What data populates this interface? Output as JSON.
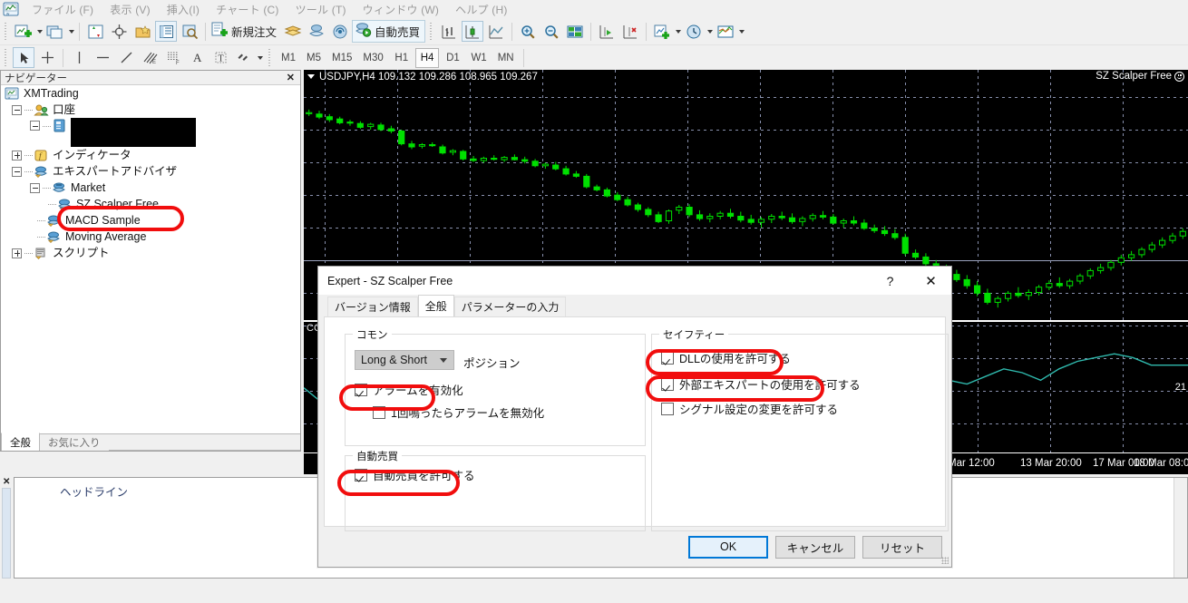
{
  "app": {
    "logo_icon": "mt4-app-icon",
    "menu": [
      {
        "label": "ファイル (F)"
      },
      {
        "label": "表示 (V)"
      },
      {
        "label": "挿入(I)"
      },
      {
        "label": "チャート (C)"
      },
      {
        "label": "ツール (T)"
      },
      {
        "label": "ウィンドウ (W)"
      },
      {
        "label": "ヘルプ (H)"
      }
    ]
  },
  "toolbar": {
    "new_order_label": "新規注文",
    "autotrade_label": "自動売買",
    "timeframes": [
      {
        "label": "M1",
        "active": false
      },
      {
        "label": "M5",
        "active": false
      },
      {
        "label": "M15",
        "active": false
      },
      {
        "label": "M30",
        "active": false
      },
      {
        "label": "H1",
        "active": false
      },
      {
        "label": "H4",
        "active": true
      },
      {
        "label": "D1",
        "active": false
      },
      {
        "label": "W1",
        "active": false
      },
      {
        "label": "MN",
        "active": false
      }
    ]
  },
  "navigator": {
    "title": "ナビゲーター",
    "close_label": "✕",
    "tree": {
      "root": "XMTrading",
      "accounts_label": "口座",
      "account_redacted": "",
      "indicators_label": "インディケータ",
      "experts_label": "エキスパートアドバイザ",
      "market_label": "Market",
      "expert_items": [
        {
          "label": "SZ Scalper Free",
          "highlighted": true
        },
        {
          "label": "MACD Sample",
          "highlighted": false
        },
        {
          "label": "Moving Average",
          "highlighted": false
        }
      ],
      "scripts_label": "スクリプト"
    },
    "tabs": [
      {
        "label": "全般",
        "selected": true
      },
      {
        "label": "お気に入り",
        "selected": false
      }
    ]
  },
  "terminal": {
    "close_label": "✕",
    "headline_label": "ヘッドライン"
  },
  "chart_data": {
    "type": "line",
    "title": "USDJPY,H4  109.132 109.286 108.965 109.267",
    "symbol": "USDJPY",
    "timeframe": "H4",
    "ohlc": {
      "open": "109.132",
      "high": "109.286",
      "low": "108.965",
      "close": "109.267"
    },
    "expert_label": "SZ Scalper Free",
    "expert_status_icon": "smiley-face-icon",
    "grid": true,
    "candle_color": "#00e000",
    "indicator_color": "#2fb9ad",
    "subwindow_label": "CCI",
    "xlabel": "",
    "ylabel": "",
    "x_ticks": [
      "Mar 12:00",
      "13 Mar 20:00",
      "17 Mar 00:00",
      "18 Mar 08:00"
    ],
    "x_tick_positions": [
      710,
      790,
      870,
      915
    ],
    "y_ticks": [
      "21"
    ],
    "candles": [
      {
        "o": 109.95,
        "h": 110.05,
        "l": 109.88,
        "c": 109.97
      },
      {
        "o": 109.93,
        "h": 110.02,
        "l": 109.8,
        "c": 109.85
      },
      {
        "o": 109.86,
        "h": 109.93,
        "l": 109.72,
        "c": 109.78
      },
      {
        "o": 109.8,
        "h": 109.86,
        "l": 109.66,
        "c": 109.7
      },
      {
        "o": 109.72,
        "h": 109.78,
        "l": 109.62,
        "c": 109.69
      },
      {
        "o": 109.68,
        "h": 109.74,
        "l": 109.54,
        "c": 109.58
      },
      {
        "o": 109.6,
        "h": 109.7,
        "l": 109.52,
        "c": 109.66
      },
      {
        "o": 109.64,
        "h": 109.7,
        "l": 109.48,
        "c": 109.52
      },
      {
        "o": 109.54,
        "h": 109.62,
        "l": 109.42,
        "c": 109.48
      },
      {
        "o": 109.48,
        "h": 109.52,
        "l": 109.1,
        "c": 109.14
      },
      {
        "o": 109.14,
        "h": 109.22,
        "l": 109.0,
        "c": 109.06
      },
      {
        "o": 109.08,
        "h": 109.16,
        "l": 109.02,
        "c": 109.12
      },
      {
        "o": 109.12,
        "h": 109.18,
        "l": 109.06,
        "c": 109.1
      },
      {
        "o": 109.06,
        "h": 109.12,
        "l": 108.86,
        "c": 108.9
      },
      {
        "o": 108.92,
        "h": 109.0,
        "l": 108.84,
        "c": 108.96
      },
      {
        "o": 108.94,
        "h": 108.98,
        "l": 108.7,
        "c": 108.74
      },
      {
        "o": 108.74,
        "h": 108.82,
        "l": 108.66,
        "c": 108.7
      },
      {
        "o": 108.7,
        "h": 108.8,
        "l": 108.64,
        "c": 108.76
      },
      {
        "o": 108.76,
        "h": 108.84,
        "l": 108.7,
        "c": 108.74
      },
      {
        "o": 108.72,
        "h": 108.82,
        "l": 108.66,
        "c": 108.78
      },
      {
        "o": 108.78,
        "h": 108.86,
        "l": 108.7,
        "c": 108.72
      },
      {
        "o": 108.72,
        "h": 108.8,
        "l": 108.62,
        "c": 108.68
      },
      {
        "o": 108.68,
        "h": 108.74,
        "l": 108.52,
        "c": 108.56
      },
      {
        "o": 108.56,
        "h": 108.64,
        "l": 108.48,
        "c": 108.6
      },
      {
        "o": 108.58,
        "h": 108.66,
        "l": 108.44,
        "c": 108.48
      },
      {
        "o": 108.48,
        "h": 108.56,
        "l": 108.3,
        "c": 108.34
      },
      {
        "o": 108.34,
        "h": 108.42,
        "l": 108.24,
        "c": 108.28
      },
      {
        "o": 108.28,
        "h": 108.34,
        "l": 107.96,
        "c": 108.0
      },
      {
        "o": 108.0,
        "h": 108.06,
        "l": 107.88,
        "c": 107.92
      },
      {
        "o": 107.92,
        "h": 107.98,
        "l": 107.72,
        "c": 107.76
      },
      {
        "o": 107.78,
        "h": 107.86,
        "l": 107.62,
        "c": 107.66
      },
      {
        "o": 107.66,
        "h": 107.74,
        "l": 107.48,
        "c": 107.52
      },
      {
        "o": 107.52,
        "h": 107.58,
        "l": 107.34,
        "c": 107.4
      },
      {
        "o": 107.4,
        "h": 107.46,
        "l": 107.2,
        "c": 107.26
      },
      {
        "o": 107.26,
        "h": 107.34,
        "l": 107.04,
        "c": 107.08
      },
      {
        "o": 107.1,
        "h": 107.4,
        "l": 107.02,
        "c": 107.36
      },
      {
        "o": 107.38,
        "h": 107.52,
        "l": 107.28,
        "c": 107.46
      },
      {
        "o": 107.46,
        "h": 107.54,
        "l": 107.2,
        "c": 107.26
      },
      {
        "o": 107.26,
        "h": 107.38,
        "l": 107.1,
        "c": 107.16
      },
      {
        "o": 107.16,
        "h": 107.3,
        "l": 107.06,
        "c": 107.22
      },
      {
        "o": 107.22,
        "h": 107.36,
        "l": 107.14,
        "c": 107.3
      },
      {
        "o": 107.3,
        "h": 107.42,
        "l": 107.16,
        "c": 107.22
      },
      {
        "o": 107.22,
        "h": 107.34,
        "l": 107.06,
        "c": 107.12
      },
      {
        "o": 107.14,
        "h": 107.26,
        "l": 107.0,
        "c": 107.06
      },
      {
        "o": 107.06,
        "h": 107.2,
        "l": 106.92,
        "c": 107.14
      },
      {
        "o": 107.14,
        "h": 107.28,
        "l": 107.04,
        "c": 107.22
      },
      {
        "o": 107.22,
        "h": 107.34,
        "l": 107.12,
        "c": 107.18
      },
      {
        "o": 107.18,
        "h": 107.3,
        "l": 107.02,
        "c": 107.08
      },
      {
        "o": 107.08,
        "h": 107.22,
        "l": 106.96,
        "c": 107.16
      },
      {
        "o": 107.16,
        "h": 107.3,
        "l": 107.08,
        "c": 107.24
      },
      {
        "o": 107.24,
        "h": 107.36,
        "l": 107.14,
        "c": 107.2
      },
      {
        "o": 107.2,
        "h": 107.28,
        "l": 107.0,
        "c": 107.04
      },
      {
        "o": 107.04,
        "h": 107.16,
        "l": 106.92,
        "c": 107.1
      },
      {
        "o": 107.1,
        "h": 107.22,
        "l": 106.98,
        "c": 107.04
      },
      {
        "o": 107.04,
        "h": 107.14,
        "l": 106.86,
        "c": 106.9
      },
      {
        "o": 106.9,
        "h": 107.0,
        "l": 106.78,
        "c": 106.84
      },
      {
        "o": 106.84,
        "h": 106.96,
        "l": 106.7,
        "c": 106.76
      },
      {
        "o": 106.76,
        "h": 106.88,
        "l": 106.6,
        "c": 106.66
      },
      {
        "o": 106.66,
        "h": 106.76,
        "l": 106.18,
        "c": 106.24
      },
      {
        "o": 106.24,
        "h": 106.34,
        "l": 106.08,
        "c": 106.14
      },
      {
        "o": 106.14,
        "h": 106.24,
        "l": 105.9,
        "c": 105.96
      },
      {
        "o": 105.96,
        "h": 106.06,
        "l": 105.78,
        "c": 105.84
      },
      {
        "o": 105.84,
        "h": 105.94,
        "l": 105.62,
        "c": 105.68
      },
      {
        "o": 105.68,
        "h": 105.8,
        "l": 105.48,
        "c": 105.54
      },
      {
        "o": 105.54,
        "h": 105.66,
        "l": 105.3,
        "c": 105.38
      },
      {
        "o": 105.38,
        "h": 105.5,
        "l": 105.1,
        "c": 105.18
      },
      {
        "o": 105.18,
        "h": 105.3,
        "l": 104.88,
        "c": 104.94
      },
      {
        "o": 104.94,
        "h": 105.1,
        "l": 104.8,
        "c": 105.04
      },
      {
        "o": 105.04,
        "h": 105.24,
        "l": 104.96,
        "c": 105.18
      },
      {
        "o": 105.18,
        "h": 105.34,
        "l": 105.06,
        "c": 105.12
      },
      {
        "o": 105.12,
        "h": 105.28,
        "l": 105.0,
        "c": 105.2
      },
      {
        "o": 105.2,
        "h": 105.4,
        "l": 105.12,
        "c": 105.34
      },
      {
        "o": 105.34,
        "h": 105.52,
        "l": 105.26,
        "c": 105.44
      },
      {
        "o": 105.44,
        "h": 105.6,
        "l": 105.32,
        "c": 105.38
      },
      {
        "o": 105.38,
        "h": 105.56,
        "l": 105.3,
        "c": 105.5
      },
      {
        "o": 105.5,
        "h": 105.7,
        "l": 105.42,
        "c": 105.64
      },
      {
        "o": 105.64,
        "h": 105.84,
        "l": 105.56,
        "c": 105.78
      },
      {
        "o": 105.78,
        "h": 105.96,
        "l": 105.7,
        "c": 105.86
      },
      {
        "o": 105.86,
        "h": 106.06,
        "l": 105.78,
        "c": 106.0
      },
      {
        "o": 106.0,
        "h": 106.2,
        "l": 105.92,
        "c": 106.12
      },
      {
        "o": 106.12,
        "h": 106.3,
        "l": 106.04,
        "c": 106.2
      },
      {
        "o": 106.2,
        "h": 106.4,
        "l": 106.12,
        "c": 106.34
      },
      {
        "o": 106.34,
        "h": 106.54,
        "l": 106.26,
        "c": 106.46
      },
      {
        "o": 106.46,
        "h": 106.66,
        "l": 106.38,
        "c": 106.58
      },
      {
        "o": 106.58,
        "h": 106.78,
        "l": 106.5,
        "c": 106.7
      },
      {
        "o": 106.7,
        "h": 106.9,
        "l": 106.62,
        "c": 106.82
      }
    ],
    "indicator_values": [
      14,
      10,
      8,
      12,
      17,
      21,
      24,
      26,
      25,
      23,
      20,
      18,
      17,
      16,
      14,
      9,
      5,
      4,
      5,
      6,
      6,
      7,
      9,
      7,
      7,
      8,
      10,
      12,
      15,
      18,
      21,
      23,
      22,
      20,
      18,
      16,
      15,
      17,
      19,
      18,
      16,
      19,
      21,
      22,
      23,
      22,
      20,
      20,
      20
    ],
    "indicator_range": [
      0,
      30
    ]
  },
  "dialog": {
    "title": "Expert - SZ Scalper Free",
    "help_label": "?",
    "close_label": "✕",
    "tabs": [
      {
        "label": "バージョン情報",
        "selected": false
      },
      {
        "label": "全般",
        "selected": true
      },
      {
        "label": "パラメーターの入力",
        "selected": false
      }
    ],
    "common": {
      "legend": "コモン",
      "position_value": "Long & Short",
      "position_label": "ポジション",
      "enable_alarm": {
        "label": "アラームを有効化",
        "checked": true,
        "highlighted": true
      },
      "disable_after_one": {
        "label": "1回鳴ったらアラームを無効化",
        "checked": false,
        "highlighted": false
      }
    },
    "autotrade": {
      "legend": "自動売買",
      "allow_autotrade": {
        "label": "自動売買を許可する",
        "checked": true,
        "highlighted": true
      }
    },
    "safety": {
      "legend": "セイフティー",
      "allow_dll": {
        "label": "DLLの使用を許可する",
        "checked": true,
        "highlighted": true
      },
      "allow_external_expert": {
        "label": "外部エキスパートの使用を許可する",
        "checked": true,
        "highlighted": true
      },
      "allow_signal_change": {
        "label": "シグナル設定の変更を許可する",
        "checked": false,
        "highlighted": false
      }
    },
    "buttons": {
      "ok": "OK",
      "cancel": "キャンセル",
      "reset": "リセット"
    }
  },
  "colors": {
    "highlight_red": "#f10d0d",
    "accent_blue": "#0078d7",
    "chart_bg": "#000000",
    "candle_green": "#00e000",
    "indicator_teal": "#2fb9ad"
  }
}
